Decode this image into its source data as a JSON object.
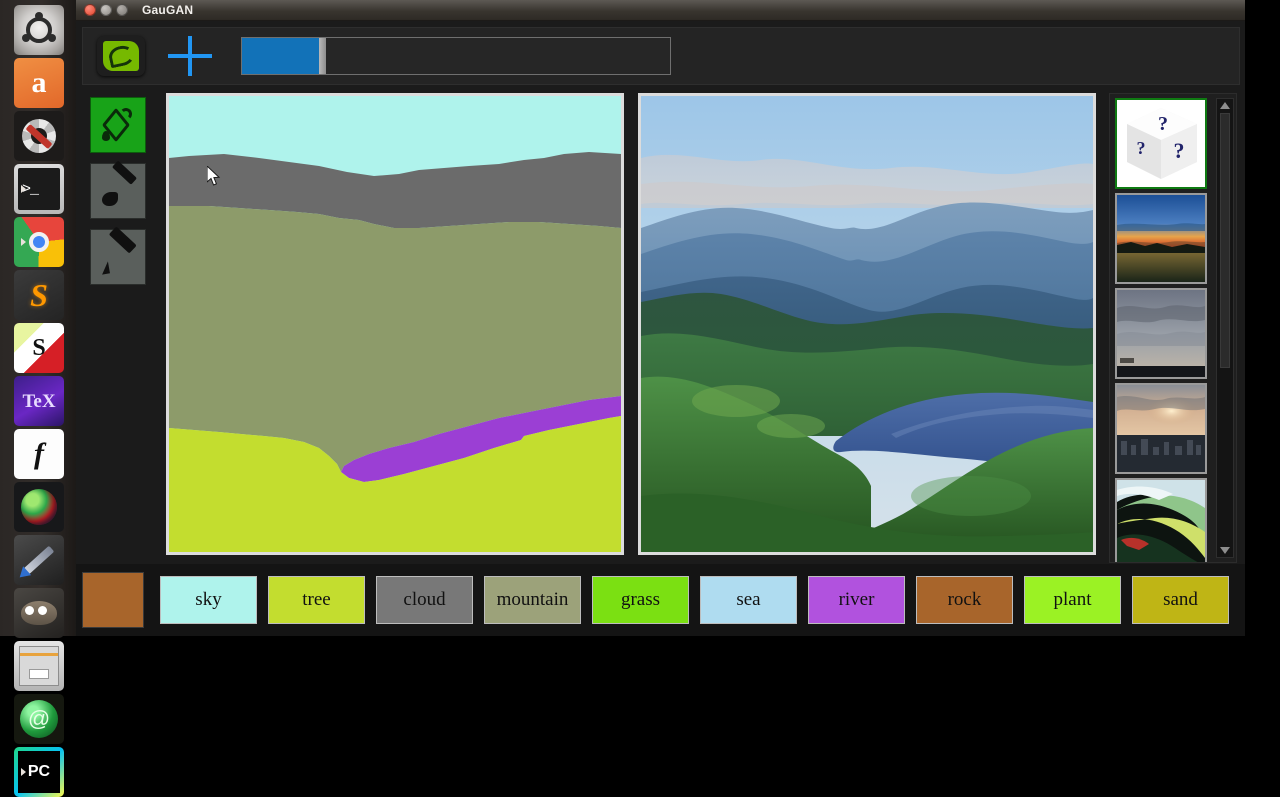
{
  "window": {
    "title": "GauGAN",
    "controls": [
      "close",
      "minimize",
      "maximize"
    ]
  },
  "launcher": {
    "items": [
      {
        "name": "ubuntu-dash",
        "label": "Ubuntu Dash",
        "icon": "ubuntu-icon",
        "running": false
      },
      {
        "name": "amazon",
        "label": "Amazon",
        "icon": "amazon-icon",
        "glyph": "a",
        "running": false
      },
      {
        "name": "system-settings",
        "label": "System Settings",
        "icon": "gear-wrench-icon",
        "running": false
      },
      {
        "name": "terminal",
        "label": "Terminal",
        "icon": "terminal-icon",
        "glyph": ">_",
        "running": true
      },
      {
        "name": "chrome",
        "label": "Google Chrome",
        "icon": "chrome-icon",
        "running": true
      },
      {
        "name": "sublime-text",
        "label": "Sublime Text",
        "icon": "sublime-icon",
        "glyph": "S",
        "running": false
      },
      {
        "name": "skim",
        "label": "Skim",
        "icon": "skim-icon",
        "glyph": "S",
        "running": false
      },
      {
        "name": "texstudio",
        "label": "TeXstudio",
        "icon": "tex-icon",
        "glyph": "TeX",
        "running": false
      },
      {
        "name": "mathematics",
        "label": "Function",
        "icon": "function-icon",
        "glyph": "f",
        "running": false
      },
      {
        "name": "color-tool",
        "label": "Color Tool",
        "icon": "color-wheel-icon",
        "running": false
      },
      {
        "name": "inkscape",
        "label": "Inkscape",
        "icon": "pen-icon",
        "running": false
      },
      {
        "name": "gimp",
        "label": "GIMP",
        "icon": "gimp-icon",
        "running": false
      },
      {
        "name": "files",
        "label": "Files",
        "icon": "file-cabinet-icon",
        "running": false
      },
      {
        "name": "green-app",
        "label": "Green App",
        "icon": "green-orb-icon",
        "running": false
      },
      {
        "name": "pycharm",
        "label": "PyCharm",
        "icon": "pycharm-icon",
        "glyph": "PC",
        "running": true
      }
    ]
  },
  "toolbar": {
    "logo_name": "nvidia-logo",
    "add_label": "+",
    "slider": {
      "name": "style-strength-slider",
      "fill_percent": 18
    }
  },
  "tools": {
    "items": [
      {
        "name": "fill-bucket-tool",
        "label": "Fill",
        "icon": "paint-bucket-icon",
        "active": true
      },
      {
        "name": "brush-tool",
        "label": "Brush",
        "icon": "paintbrush-icon",
        "active": false
      },
      {
        "name": "pencil-tool",
        "label": "Pencil",
        "icon": "pencil-icon",
        "active": false
      }
    ]
  },
  "canvas": {
    "segmentation": {
      "name": "segmentation-canvas",
      "regions": [
        {
          "label": "sky",
          "color": "#AFF3EC"
        },
        {
          "label": "cloud",
          "color": "#6B6B6B"
        },
        {
          "label": "mountain",
          "color": "#8D9B6A"
        },
        {
          "label": "river",
          "color": "#9B3FD4"
        },
        {
          "label": "tree",
          "color": "#C3DD2F"
        }
      ]
    },
    "output": {
      "name": "generated-image-canvas",
      "description": "Generated photorealistic landscape: blue sky, layered blue mountains, green forested valley, blue lake"
    }
  },
  "styles": {
    "scrollbar_name": "style-scrollbar",
    "thumbnails": [
      {
        "name": "style-random",
        "title": "Random",
        "icon": "question-dice-icon",
        "selected": true
      },
      {
        "name": "style-sunset-water",
        "title": "Sunset over water",
        "selected": false
      },
      {
        "name": "style-cloudy-sky",
        "title": "Cloudy sky",
        "selected": false
      },
      {
        "name": "style-sunset-city",
        "title": "Sunset over city",
        "selected": false
      },
      {
        "name": "style-watercolor-wave",
        "title": "Watercolor wave",
        "selected": false
      }
    ]
  },
  "labels": {
    "current_color": "#A8652B",
    "items": [
      {
        "label": "sky",
        "color": "#AFF3EC",
        "text_color": "#111111"
      },
      {
        "label": "tree",
        "color": "#C3DD2F",
        "text_color": "#111111"
      },
      {
        "label": "cloud",
        "color": "#787878",
        "text_color": "#111111"
      },
      {
        "label": "mountain",
        "color": "#9CA27A",
        "text_color": "#111111"
      },
      {
        "label": "grass",
        "color": "#7BE012",
        "text_color": "#111111"
      },
      {
        "label": "sea",
        "color": "#AFDCF0",
        "text_color": "#111111"
      },
      {
        "label": "river",
        "color": "#B152DE",
        "text_color": "#111111"
      },
      {
        "label": "rock",
        "color": "#A8652B",
        "text_color": "#111111"
      },
      {
        "label": "plant",
        "color": "#9BF224",
        "text_color": "#111111"
      },
      {
        "label": "sand",
        "color": "#BFB515",
        "text_color": "#111111"
      }
    ]
  }
}
